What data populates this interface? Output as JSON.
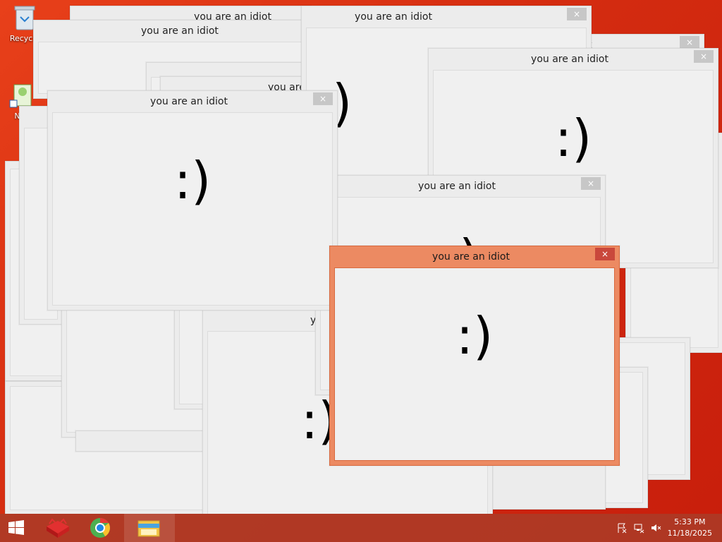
{
  "desktop": {
    "icons": [
      {
        "label": "Recycle"
      },
      {
        "label": "Not"
      }
    ]
  },
  "windows": {
    "title": "you are an idiot",
    "face": ":)",
    "close": "×",
    "partial_title_a": "you are an idiot",
    "partial_title_b": "you are",
    "partial_title_c": "you are an idiot"
  },
  "taskbar": {
    "time": "5:33 PM",
    "date": "11/18/2025"
  },
  "colors": {
    "desktop_bg": "#d8361a",
    "active_frame": "#ec8a62",
    "inactive_frame": "#ececec",
    "close_active": "#c9483c"
  },
  "icons": [
    "recycle-bin-icon",
    "notepad-icon",
    "windows-logo-icon",
    "app-icon",
    "chrome-icon",
    "file-explorer-icon",
    "flag-icon",
    "network-icon",
    "volume-muted-icon"
  ]
}
